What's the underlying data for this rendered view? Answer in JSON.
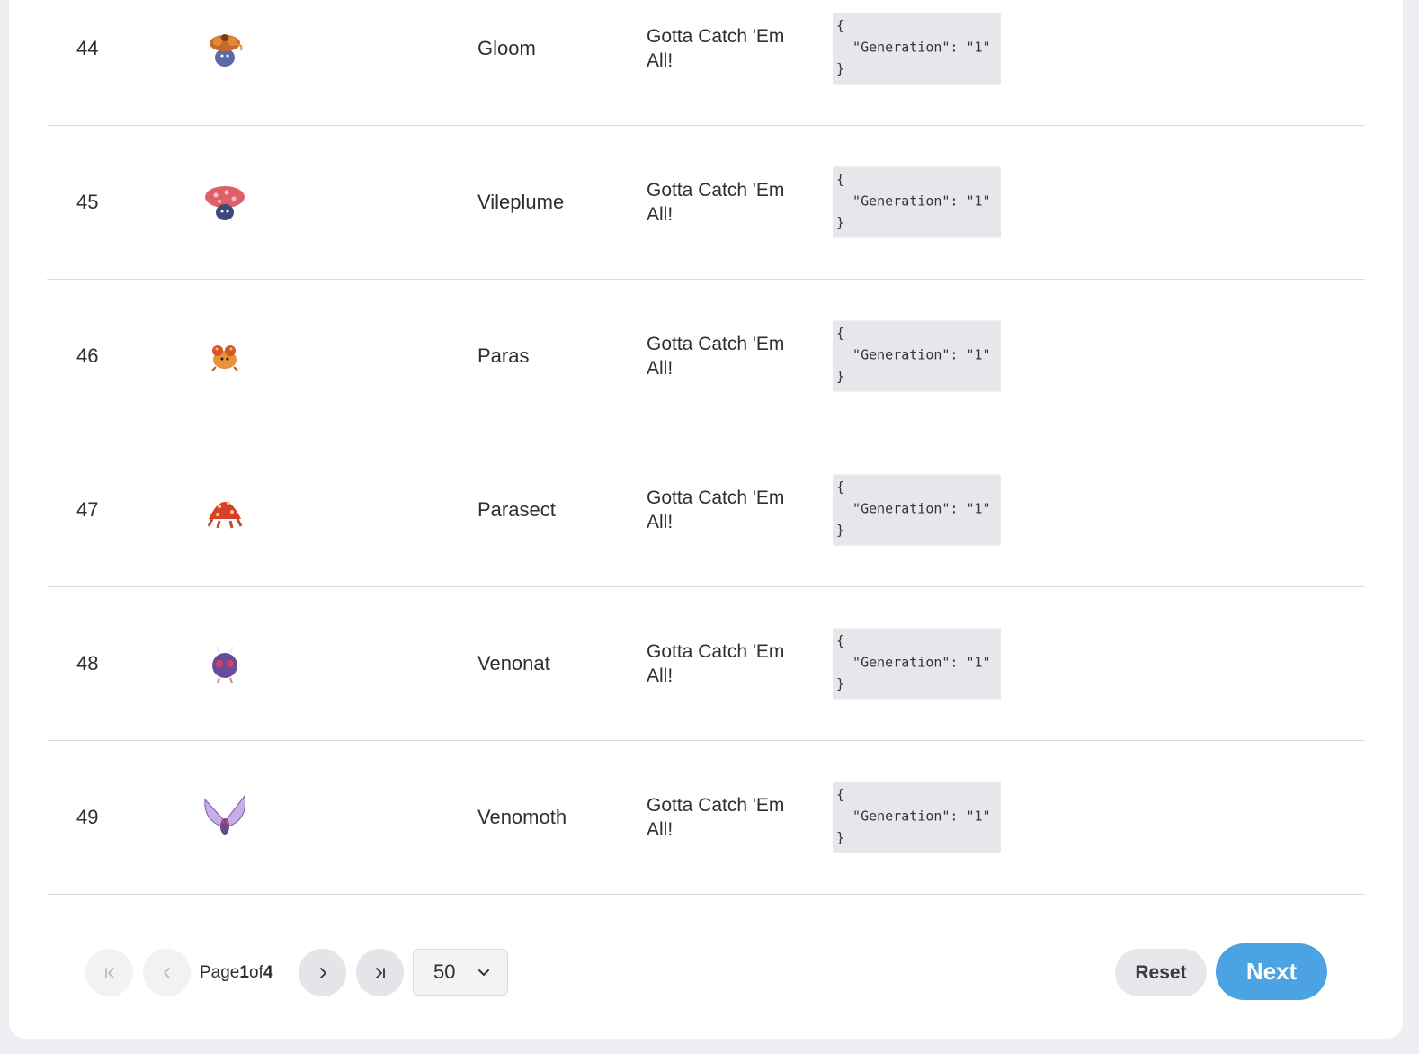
{
  "table": {
    "rows": [
      {
        "id": "44",
        "name": "Gloom",
        "description": "Gotta Catch 'Em All!",
        "json": "{\n  \"Generation\": \"1\"\n}",
        "sprite": "gloom-sprite"
      },
      {
        "id": "45",
        "name": "Vileplume",
        "description": "Gotta Catch 'Em All!",
        "json": "{\n  \"Generation\": \"1\"\n}",
        "sprite": "vileplume-sprite"
      },
      {
        "id": "46",
        "name": "Paras",
        "description": "Gotta Catch 'Em All!",
        "json": "{\n  \"Generation\": \"1\"\n}",
        "sprite": "paras-sprite"
      },
      {
        "id": "47",
        "name": "Parasect",
        "description": "Gotta Catch 'Em All!",
        "json": "{\n  \"Generation\": \"1\"\n}",
        "sprite": "parasect-sprite"
      },
      {
        "id": "48",
        "name": "Venonat",
        "description": "Gotta Catch 'Em All!",
        "json": "{\n  \"Generation\": \"1\"\n}",
        "sprite": "venonat-sprite"
      },
      {
        "id": "49",
        "name": "Venomoth",
        "description": "Gotta Catch 'Em All!",
        "json": "{\n  \"Generation\": \"1\"\n}",
        "sprite": "venomoth-sprite"
      }
    ]
  },
  "pagination": {
    "page_word": "Page",
    "current_page": "1",
    "of_word": "of",
    "total_pages": "4",
    "page_size": "50",
    "icons": {
      "first": "first-page-icon",
      "prev": "prev-page-icon",
      "next": "next-page-icon",
      "last": "last-page-icon",
      "dropdown": "chevron-down-icon"
    }
  },
  "actions": {
    "reset_label": "Reset",
    "next_label": "Next"
  },
  "colors": {
    "primary": "#4ba3e3",
    "json_bg": "#e6e6eb",
    "page_bg": "#efeff3"
  }
}
